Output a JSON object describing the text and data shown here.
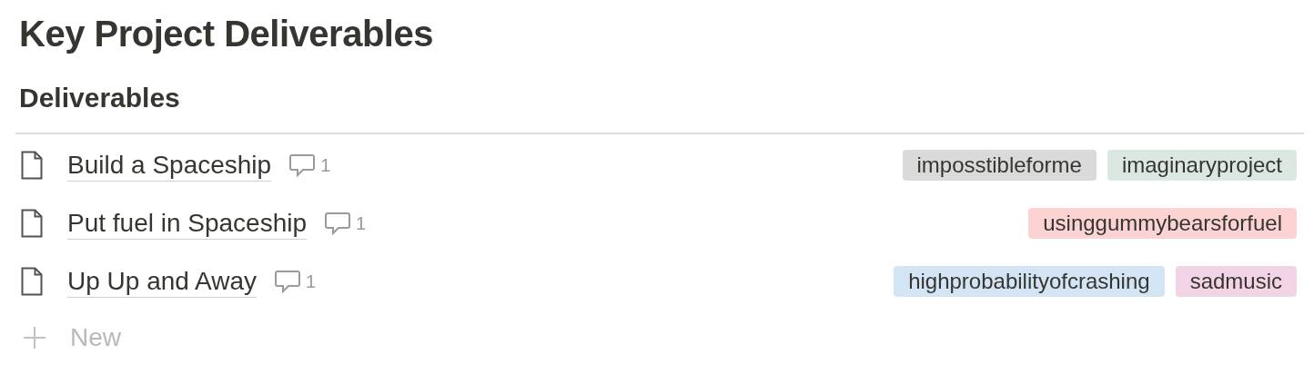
{
  "title": "Key Project Deliverables",
  "view": {
    "title": "Deliverables",
    "rows": [
      {
        "title": "Build a Spaceship",
        "comments": "1",
        "tags": [
          {
            "label": "imposstibleforme",
            "color": "#dadada"
          },
          {
            "label": "imaginaryproject",
            "color": "#dbe8e2"
          }
        ]
      },
      {
        "title": "Put fuel in Spaceship",
        "comments": "1",
        "tags": [
          {
            "label": "usinggummybearsforfuel",
            "color": "#fbd3d3"
          }
        ]
      },
      {
        "title": "Up Up and Away",
        "comments": "1",
        "tags": [
          {
            "label": "highprobabilityofcrashing",
            "color": "#d3e4f5"
          },
          {
            "label": "sadmusic",
            "color": "#f3d4e7"
          }
        ]
      }
    ],
    "new_button": "New"
  }
}
